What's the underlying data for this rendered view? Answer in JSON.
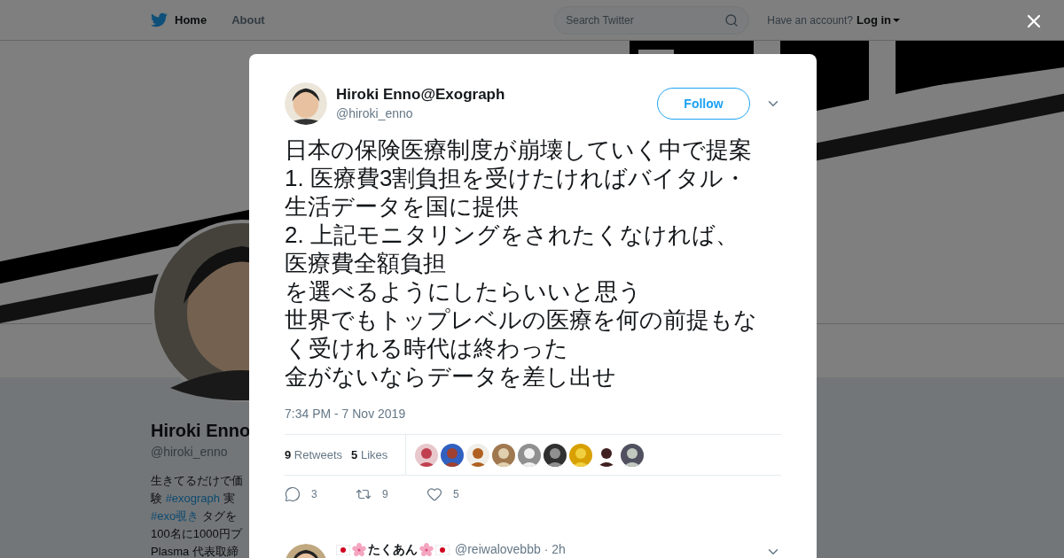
{
  "nav": {
    "items": [
      {
        "label": "Home",
        "selected": true
      },
      {
        "label": "About",
        "selected": false
      }
    ],
    "search": {
      "placeholder": "Search Twitter"
    },
    "account_prompt": "Have an account?",
    "login": "Log in"
  },
  "profile": {
    "name": "Hiroki Enno",
    "handle": "@hiroki_enno",
    "bio_lines": [
      "生きてるだけで価",
      "験 **#exograph** 実",
      "**#exo覗き** タグを",
      "100名に1000円プ",
      "Plasma 代表取締"
    ]
  },
  "tweet": {
    "author": "Hiroki Enno@Exograph",
    "handle": "@hiroki_enno",
    "follow": "Follow",
    "lines": [
      "日本の保険医療制度が崩壊していく中で提案",
      "1. 医療費3割負担を受けたければバイタル・",
      "生活データを国に提供",
      "2. 上記モニタリングをされたくなければ、",
      "医療費全額負担",
      "を選べるようにしたらいいと思う",
      "世界でもトップレベルの医療を何の前提もな",
      "く受けれる時代は終わった",
      "金がないならデータを差し出せ"
    ],
    "timestamp": "7:34 PM - 7 Nov 2019",
    "stats": [
      {
        "count": "9",
        "label": "Retweets"
      },
      {
        "count": "5",
        "label": "Likes"
      }
    ],
    "actions": [
      {
        "kind": "reply",
        "count": "3"
      },
      {
        "kind": "retweet",
        "count": "9"
      },
      {
        "kind": "like",
        "count": "5"
      }
    ]
  },
  "reply": {
    "name": "たくあん",
    "handle": "@reiwalovebbb",
    "time": "· 2h"
  }
}
